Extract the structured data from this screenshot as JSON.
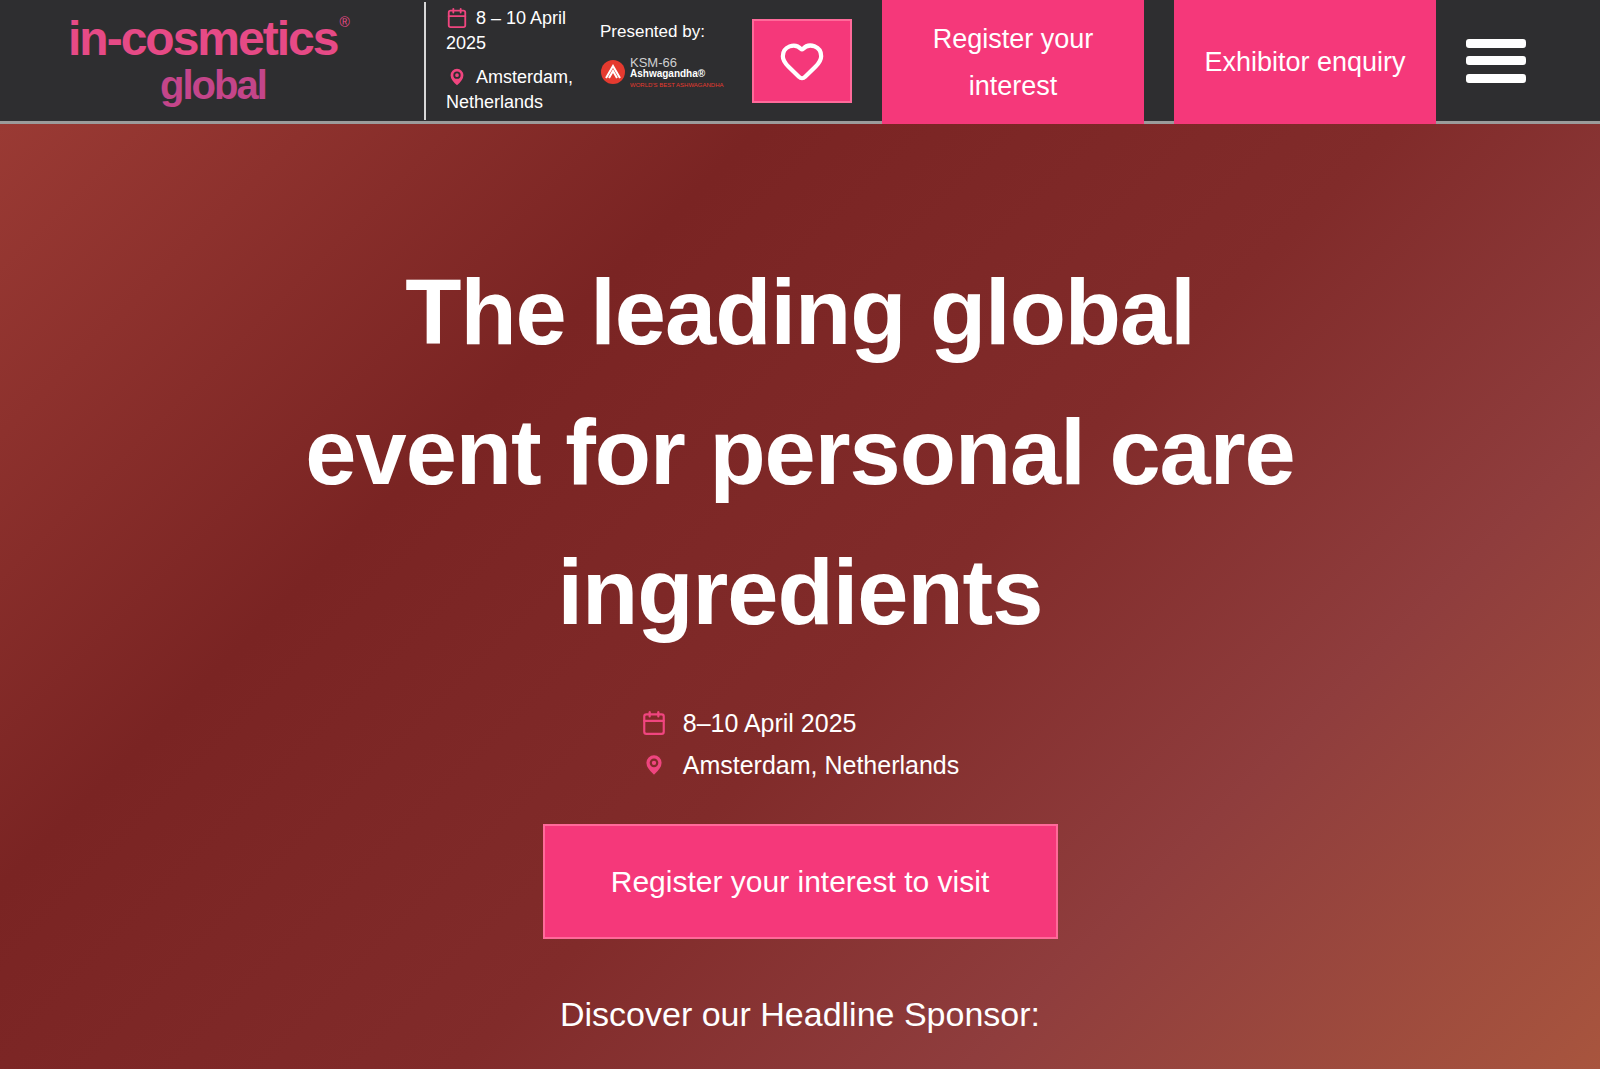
{
  "header": {
    "logo": {
      "main": "in-cosmetics",
      "mark": "®",
      "sub": "global"
    },
    "date": "8 – 10 April 2025",
    "location": "Amsterdam, Netherlands",
    "presented_by": "Presented by:",
    "sponsor_logo": {
      "name": "KSM-66",
      "product": "Ashwagandha",
      "mark": "®",
      "tagline": "WORLD'S BEST ASHWAGANDHA"
    },
    "buttons": [
      {
        "kind": "favourite",
        "label": ""
      },
      {
        "kind": "text",
        "label": "Register your interest"
      },
      {
        "kind": "text",
        "label": "Exhibitor enquiry"
      },
      {
        "kind": "menu",
        "label": ""
      }
    ]
  },
  "hero": {
    "title_lines": [
      "The leading global",
      "event for personal care",
      "ingredients"
    ],
    "date": "8–10 April 2025",
    "location": "Amsterdam, Netherlands",
    "cta": "Register your interest to visit",
    "sponsor_heading": "Discover our Headline Sponsor:"
  }
}
